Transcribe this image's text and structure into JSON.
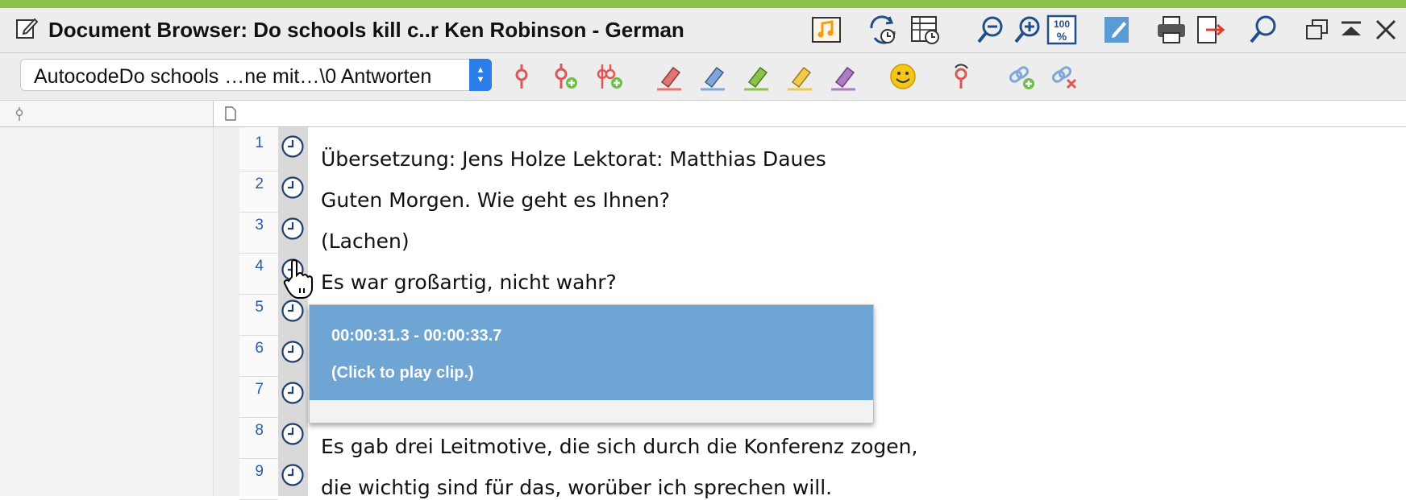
{
  "window": {
    "title": "Document Browser: Do schools kill c..r Ken Robinson - German",
    "accent_color": "#8bc34a",
    "title_icon": "edit-document-icon",
    "title_toolbar": [
      {
        "name": "media-player-icon"
      },
      {
        "name": "sync-timestamps-icon"
      },
      {
        "name": "timestamp-table-icon"
      },
      {
        "name": "zoom-out-icon"
      },
      {
        "name": "zoom-in-icon"
      },
      {
        "name": "zoom-100-icon",
        "label": "100"
      },
      {
        "name": "edit-mode-icon"
      },
      {
        "name": "print-icon"
      },
      {
        "name": "export-icon"
      },
      {
        "name": "search-icon"
      },
      {
        "name": "restore-window-icon"
      },
      {
        "name": "collapse-window-icon"
      },
      {
        "name": "close-icon"
      }
    ]
  },
  "toolbar": {
    "code_select_value": "AutocodeDo schools …ne mit…\\0 Antworten",
    "tools": [
      {
        "name": "code-icon"
      },
      {
        "name": "add-code-icon"
      },
      {
        "name": "add-codes-icon"
      },
      {
        "name": "highlight-red-icon",
        "color": "#e57373"
      },
      {
        "name": "highlight-blue-icon",
        "color": "#7fa7d9"
      },
      {
        "name": "highlight-green-icon",
        "color": "#8bc34a"
      },
      {
        "name": "highlight-yellow-icon",
        "color": "#f2c94c"
      },
      {
        "name": "highlight-purple-icon",
        "color": "#b07cc6"
      },
      {
        "name": "emoticon-icon",
        "color": "#f5c518"
      },
      {
        "name": "memo-code-icon"
      },
      {
        "name": "add-link-icon"
      },
      {
        "name": "remove-link-icon"
      }
    ]
  },
  "header": {
    "left_column_icon": "code-column-icon",
    "right_column_icon": "document-column-icon"
  },
  "document": {
    "rows": [
      {
        "num": "1",
        "text": "Übersetzung: Jens Holze Lektorat: Matthias Daues"
      },
      {
        "num": "2",
        "text": "Guten Morgen. Wie geht es Ihnen?"
      },
      {
        "num": "3",
        "text": "(Lachen)"
      },
      {
        "num": "4",
        "text": "Es war großartig, nicht wahr?"
      },
      {
        "num": "5",
        "text": ""
      },
      {
        "num": "6",
        "text": ""
      },
      {
        "num": "7",
        "text": ""
      },
      {
        "num": "8",
        "text": "Es gab drei Leitmotive, die sich durch die Konferenz zogen,"
      },
      {
        "num": "9",
        "text": "die wichtig sind für das, worüber ich sprechen will."
      }
    ]
  },
  "tooltip": {
    "time_range": "00:00:31.3 - 00:00:33.7",
    "hint": "(Click to play clip.)",
    "background_color": "#6fa5d4"
  }
}
